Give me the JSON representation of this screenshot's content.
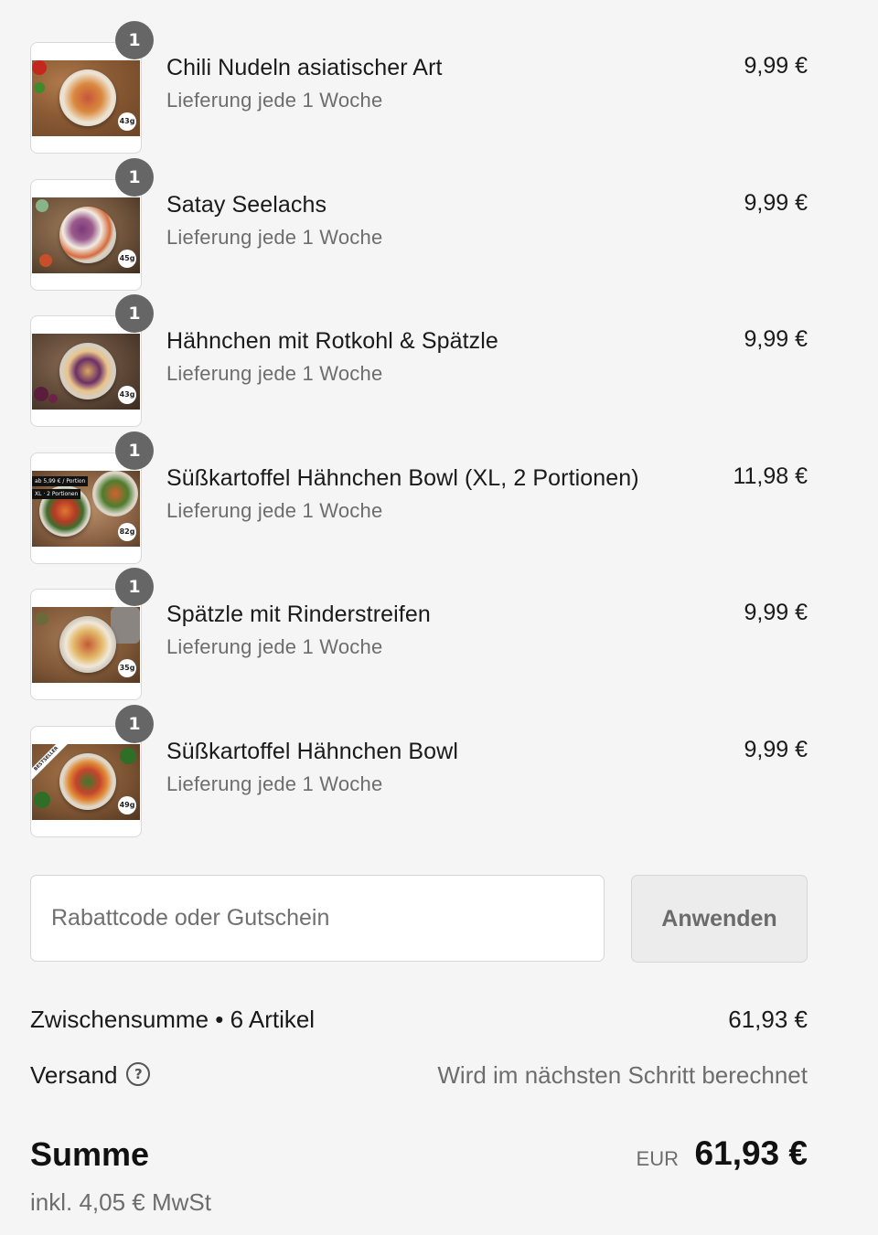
{
  "cart": {
    "items": [
      {
        "name": "Chili Nudeln asiatischer Art",
        "delivery": "Lieferung jede 1 Woche",
        "price": "9,99 €",
        "quantity": "1",
        "weight": "43g"
      },
      {
        "name": "Satay Seelachs",
        "delivery": "Lieferung jede 1 Woche",
        "price": "9,99 €",
        "quantity": "1",
        "weight": "45g"
      },
      {
        "name": "Hähnchen mit Rotkohl & Spätzle",
        "delivery": "Lieferung jede 1 Woche",
        "price": "9,99 €",
        "quantity": "1",
        "weight": "43g"
      },
      {
        "name": "Süßkartoffel Hähnchen Bowl (XL, 2 Portionen)",
        "delivery": "Lieferung jede 1 Woche",
        "price": "11,98 €",
        "quantity": "1",
        "weight": "82g",
        "promo_line1": "ab 5,99 € / Portion",
        "promo_line2": "XL · 2 Portionen"
      },
      {
        "name": "Spätzle mit Rinderstreifen",
        "delivery": "Lieferung jede 1 Woche",
        "price": "9,99 €",
        "quantity": "1",
        "weight": "35g"
      },
      {
        "name": "Süßkartoffel Hähnchen Bowl",
        "delivery": "Lieferung jede 1 Woche",
        "price": "9,99 €",
        "quantity": "1",
        "weight": "49g",
        "badge": "BESTSELLER"
      }
    ]
  },
  "discount": {
    "placeholder": "Rabattcode oder Gutschein",
    "value": "",
    "apply_label": "Anwenden"
  },
  "summary": {
    "subtotal_label": "Zwischensumme • 6 Artikel",
    "subtotal_value": "61,93 €",
    "shipping_label": "Versand",
    "shipping_help_icon": "?",
    "shipping_value": "Wird im nächsten Schritt berechnet",
    "total_label": "Summe",
    "total_currency": "EUR",
    "total_value": "61,93 €",
    "tax_note": "inkl. 4,05 € MwSt"
  },
  "colors": {
    "background": "#f5f5f5",
    "text": "#1a1a1a",
    "muted": "#6d6d6d",
    "quantity_badge": "#666666"
  }
}
